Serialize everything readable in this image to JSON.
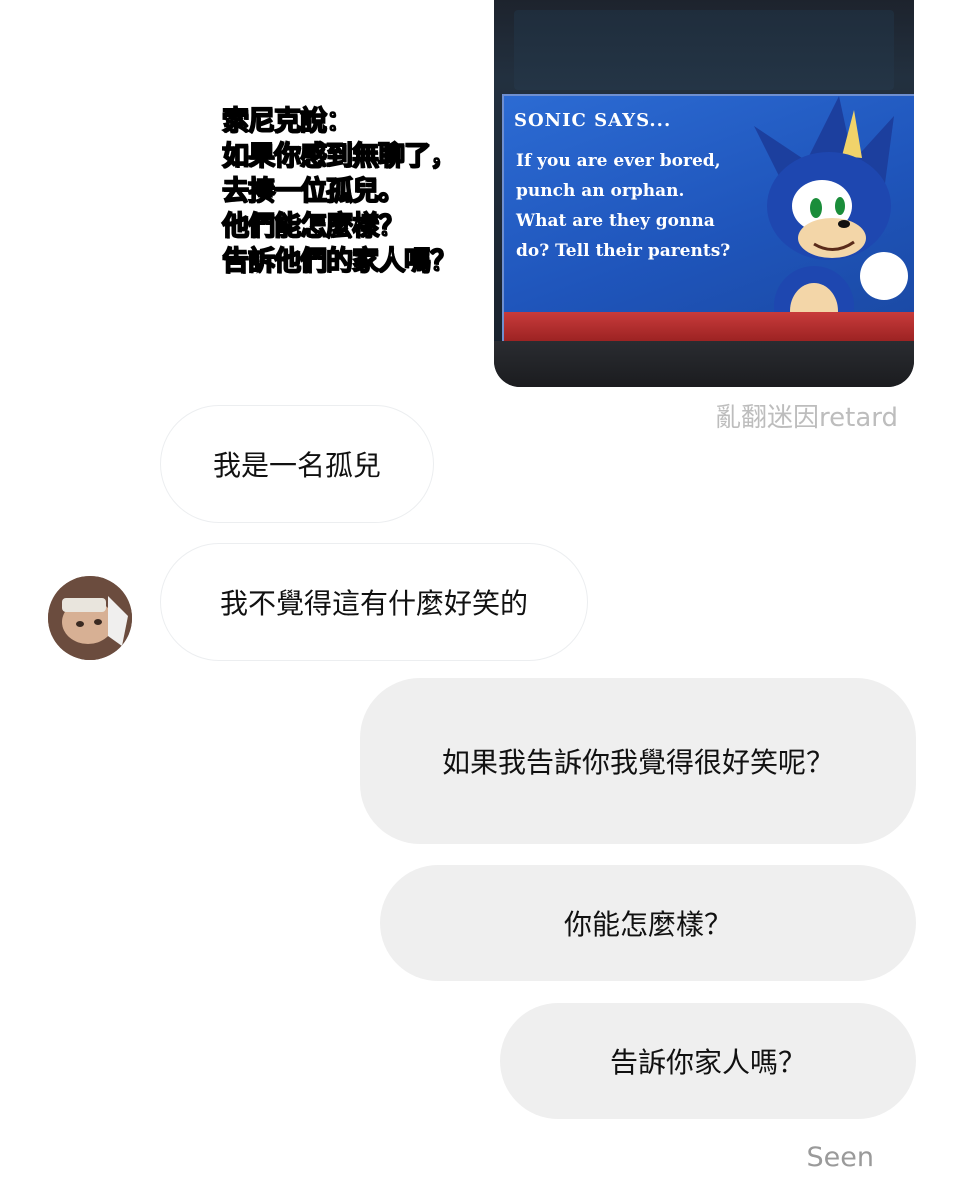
{
  "caption_lines": [
    "索尼克說：",
    "如果你感到無聊了，",
    "去揍一位孤兒。",
    "他們能怎麼樣？",
    "告訴他們的家人嗎？"
  ],
  "shared_image": {
    "title": "SONIC SAYS...",
    "text_lines": [
      "If you are ever bored,",
      "punch an orphan.",
      "What are they gonna",
      "do? Tell their parents?"
    ],
    "panel_color": "#2760c8",
    "bar_color": "#c23636"
  },
  "watermark": "亂翻迷因retard",
  "messages": [
    {
      "sender": "other",
      "text": "我是一名孤兒"
    },
    {
      "sender": "other",
      "text": "我不覺得這有什麼好笑的"
    },
    {
      "sender": "me",
      "text": "如果我告訴你我覺得很好笑呢？"
    },
    {
      "sender": "me",
      "text": "你能怎麼樣？"
    },
    {
      "sender": "me",
      "text": "告訴你家人嗎？"
    }
  ],
  "avatar_icon": "profile-photo",
  "status": "Seen"
}
